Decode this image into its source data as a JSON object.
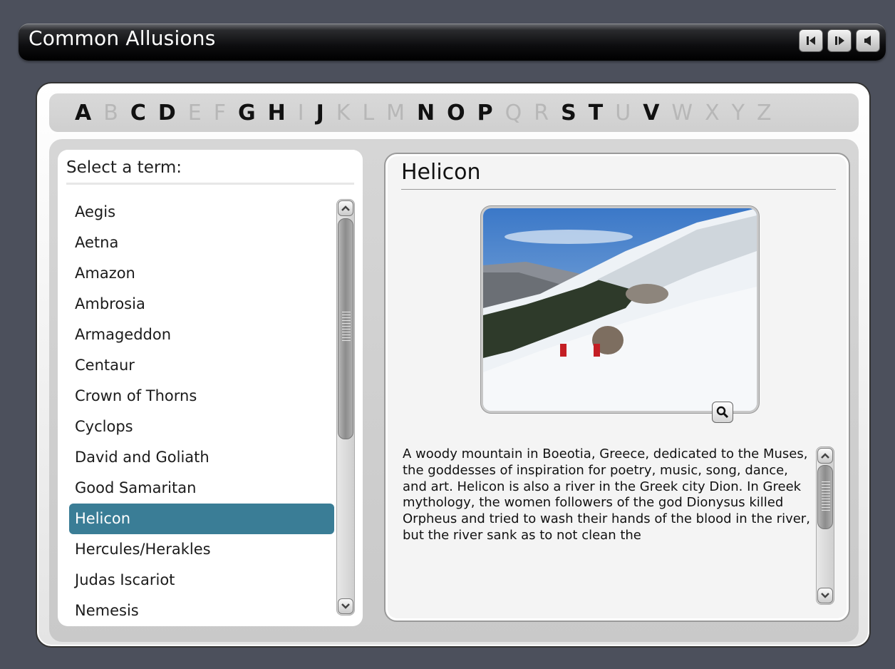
{
  "window": {
    "title": "Common Allusions",
    "buttons": [
      {
        "name": "previous-button",
        "icon": "step-back-icon"
      },
      {
        "name": "next-button",
        "icon": "step-forward-icon"
      },
      {
        "name": "audio-button",
        "icon": "speaker-icon"
      }
    ]
  },
  "alphabet": [
    {
      "letter": "A",
      "enabled": true
    },
    {
      "letter": "B",
      "enabled": false
    },
    {
      "letter": "C",
      "enabled": true
    },
    {
      "letter": "D",
      "enabled": true
    },
    {
      "letter": "E",
      "enabled": false
    },
    {
      "letter": "F",
      "enabled": false
    },
    {
      "letter": "G",
      "enabled": true
    },
    {
      "letter": "H",
      "enabled": true
    },
    {
      "letter": "I",
      "enabled": false
    },
    {
      "letter": "J",
      "enabled": true
    },
    {
      "letter": "K",
      "enabled": false
    },
    {
      "letter": "L",
      "enabled": false
    },
    {
      "letter": "M",
      "enabled": false
    },
    {
      "letter": "N",
      "enabled": true
    },
    {
      "letter": "O",
      "enabled": true
    },
    {
      "letter": "P",
      "enabled": true
    },
    {
      "letter": "Q",
      "enabled": false
    },
    {
      "letter": "R",
      "enabled": false
    },
    {
      "letter": "S",
      "enabled": true
    },
    {
      "letter": "T",
      "enabled": true
    },
    {
      "letter": "U",
      "enabled": false
    },
    {
      "letter": "V",
      "enabled": true
    },
    {
      "letter": "W",
      "enabled": false
    },
    {
      "letter": "X",
      "enabled": false
    },
    {
      "letter": "Y",
      "enabled": false
    },
    {
      "letter": "Z",
      "enabled": false
    }
  ],
  "term_list": {
    "heading": "Select a term:",
    "selected": "Helicon",
    "items": [
      "Aegis",
      "Aetna",
      "Amazon",
      "Ambrosia",
      "Armageddon",
      "Centaur",
      "Crown of Thorns",
      "Cyclops",
      "David and Goliath",
      "Good Samaritan",
      "Helicon",
      "Hercules/Herakles",
      "Judas Iscariot",
      "Nemesis"
    ]
  },
  "detail": {
    "title": "Helicon",
    "image_icon": "zoom-icon",
    "description": "A woody mountain in Boeotia, Greece, dedicated to the Muses, the goddesses of inspiration for poetry, music, song, dance, and art. Helicon is also a river in the Greek city Dion. In Greek mythology, the women followers of the god Dionysus killed Orpheus and tried to wash their hands of the blood in the river, but the river sank as to not clean the"
  },
  "colors": {
    "background": "#4c505c",
    "selection": "#3a7d96",
    "letter_enabled": "#111111",
    "letter_disabled": "#b7b7b7"
  }
}
